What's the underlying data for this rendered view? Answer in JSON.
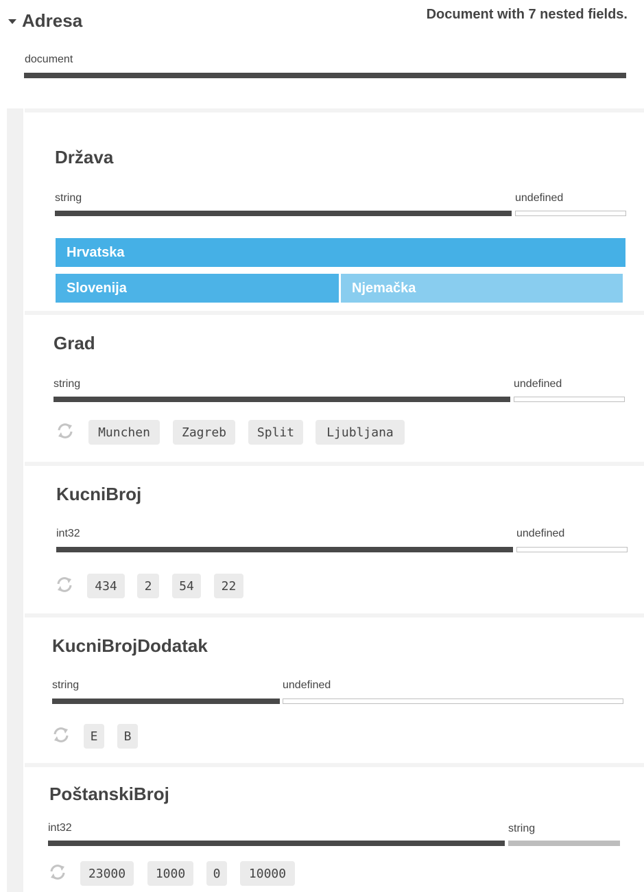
{
  "header": {
    "title": "Adresa",
    "summary": "Document with 7 nested fields.",
    "type_label": "document"
  },
  "fields": [
    {
      "name": "Država",
      "type_main": "string",
      "type_other": "undefined",
      "values": [
        "Hrvatska",
        "Slovenija",
        "Njemačka"
      ],
      "colors": {
        "primary": "#45b0e6",
        "secondary": "#89cdef"
      }
    },
    {
      "name": "Grad",
      "type_main": "string",
      "type_other": "undefined",
      "samples": [
        "Munchen",
        "Zagreb",
        "Split",
        "Ljubljana"
      ]
    },
    {
      "name": "KucniBroj",
      "type_main": "int32",
      "type_other": "undefined",
      "samples": [
        "434",
        "2",
        "54",
        "22"
      ]
    },
    {
      "name": "KucniBrojDodatak",
      "type_main": "string",
      "type_other": "undefined",
      "samples": [
        "E",
        "B"
      ]
    },
    {
      "name": "PoštanskiBroj",
      "type_main": "int32",
      "type_other": "string",
      "samples": [
        "23000",
        "1000",
        "0",
        "10000"
      ]
    }
  ],
  "icons": {
    "refresh": "refresh-icon",
    "collapse": "caret-down-icon"
  }
}
